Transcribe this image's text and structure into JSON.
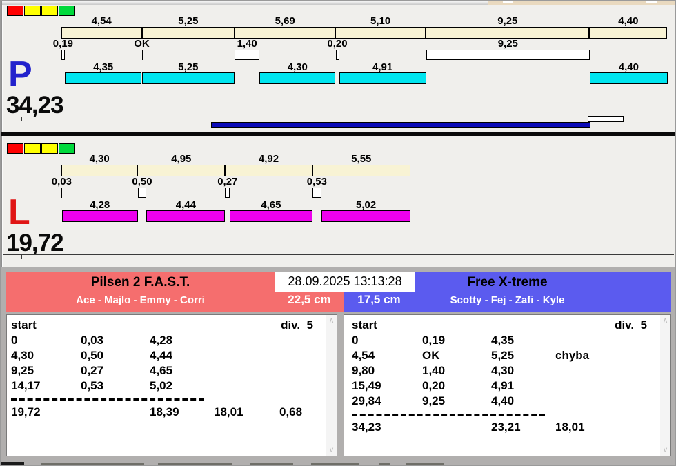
{
  "colors": {
    "main_bg": "#f0efec",
    "footer_bg": "#b1afae",
    "lap_bar": "#f8f3d4",
    "progress": "#0a0ab8"
  },
  "panels": [
    {
      "letter": "P",
      "letter_color": "#2222cc",
      "total": "34,23",
      "lights": [
        "#ff0000",
        "#ffff00",
        "#ffff00",
        "#00d93c"
      ],
      "run_color": "#00e5ef",
      "lap_segments": [
        {
          "label": "4,54",
          "value": 4.54
        },
        {
          "label": "5,25",
          "value": 5.25
        },
        {
          "label": "5,69",
          "value": 5.69
        },
        {
          "label": "5,10",
          "value": 5.1
        },
        {
          "label": "9,25",
          "value": 9.25
        },
        {
          "label": "4,40",
          "value": 4.4
        }
      ],
      "exchanges": [
        {
          "label": "0,19",
          "value": 0.19
        },
        {
          "label": "OK",
          "value": 0
        },
        {
          "label": "1,40",
          "value": 1.4
        },
        {
          "label": "0,20",
          "value": 0.2
        },
        {
          "label": "9,25",
          "value": 9.25
        }
      ],
      "runs": [
        {
          "label": "4,35",
          "value": 4.35
        },
        {
          "label": "5,25",
          "value": 5.25
        },
        {
          "label": "4,30",
          "value": 4.3
        },
        {
          "label": "4,91",
          "value": 4.91
        },
        {
          "label": "4,40",
          "value": 4.4
        }
      ]
    },
    {
      "letter": "L",
      "letter_color": "#e01515",
      "total": "19,72",
      "lights": [
        "#ff0000",
        "#ffff00",
        "#ffff00",
        "#00d93c"
      ],
      "run_color": "#ee00ee",
      "lap_segments": [
        {
          "label": "4,30",
          "value": 4.3
        },
        {
          "label": "4,95",
          "value": 4.95
        },
        {
          "label": "4,92",
          "value": 4.92
        },
        {
          "label": "5,55",
          "value": 5.55
        }
      ],
      "exchanges": [
        {
          "label": "0,03",
          "value": 0.03
        },
        {
          "label": "0,50",
          "value": 0.5
        },
        {
          "label": "0,27",
          "value": 0.27
        },
        {
          "label": "0,53",
          "value": 0.53
        }
      ],
      "runs": [
        {
          "label": "4,28",
          "value": 4.28
        },
        {
          "label": "4,44",
          "value": 4.44
        },
        {
          "label": "4,65",
          "value": 4.65
        },
        {
          "label": "5,02",
          "value": 5.02
        }
      ]
    }
  ],
  "footer": {
    "timestamp": "28.09.2025 13:13:28",
    "teams": [
      {
        "name": "Pilsen 2 F.A.S.T.",
        "handlers": "Ace - Majlo - Emmy - Corri",
        "height": "22,5 cm",
        "header_color": "#f56e6e",
        "table": {
          "header_left": "start",
          "header_right": "div.  5",
          "rows": [
            [
              "0",
              "0,03",
              "4,28",
              "",
              ""
            ],
            [
              "4,30",
              "0,50",
              "4,44",
              "",
              ""
            ],
            [
              "9,25",
              "0,27",
              "4,65",
              "",
              ""
            ],
            [
              "14,17",
              "0,53",
              "5,02",
              "",
              ""
            ]
          ],
          "totals": [
            "19,72",
            "",
            "18,39",
            "18,01",
            "0,68"
          ]
        }
      },
      {
        "name": "Free X-treme",
        "handlers": "Scotty - Fej - Zafi - Kyle",
        "height": "17,5 cm",
        "header_color": "#5b5bef",
        "table": {
          "header_left": "start",
          "header_right": "div.  5",
          "rows": [
            [
              "0",
              "0,19",
              "4,35",
              "",
              ""
            ],
            [
              "4,54",
              "OK",
              "5,25",
              "chyba",
              ""
            ],
            [
              "9,80",
              "1,40",
              "4,30",
              "",
              ""
            ],
            [
              "15,49",
              "0,20",
              "4,91",
              "",
              ""
            ],
            [
              "29,84",
              "9,25",
              "4,40",
              "",
              ""
            ]
          ],
          "totals": [
            "34,23",
            "",
            "23,21",
            "18,01",
            ""
          ]
        }
      }
    ]
  }
}
